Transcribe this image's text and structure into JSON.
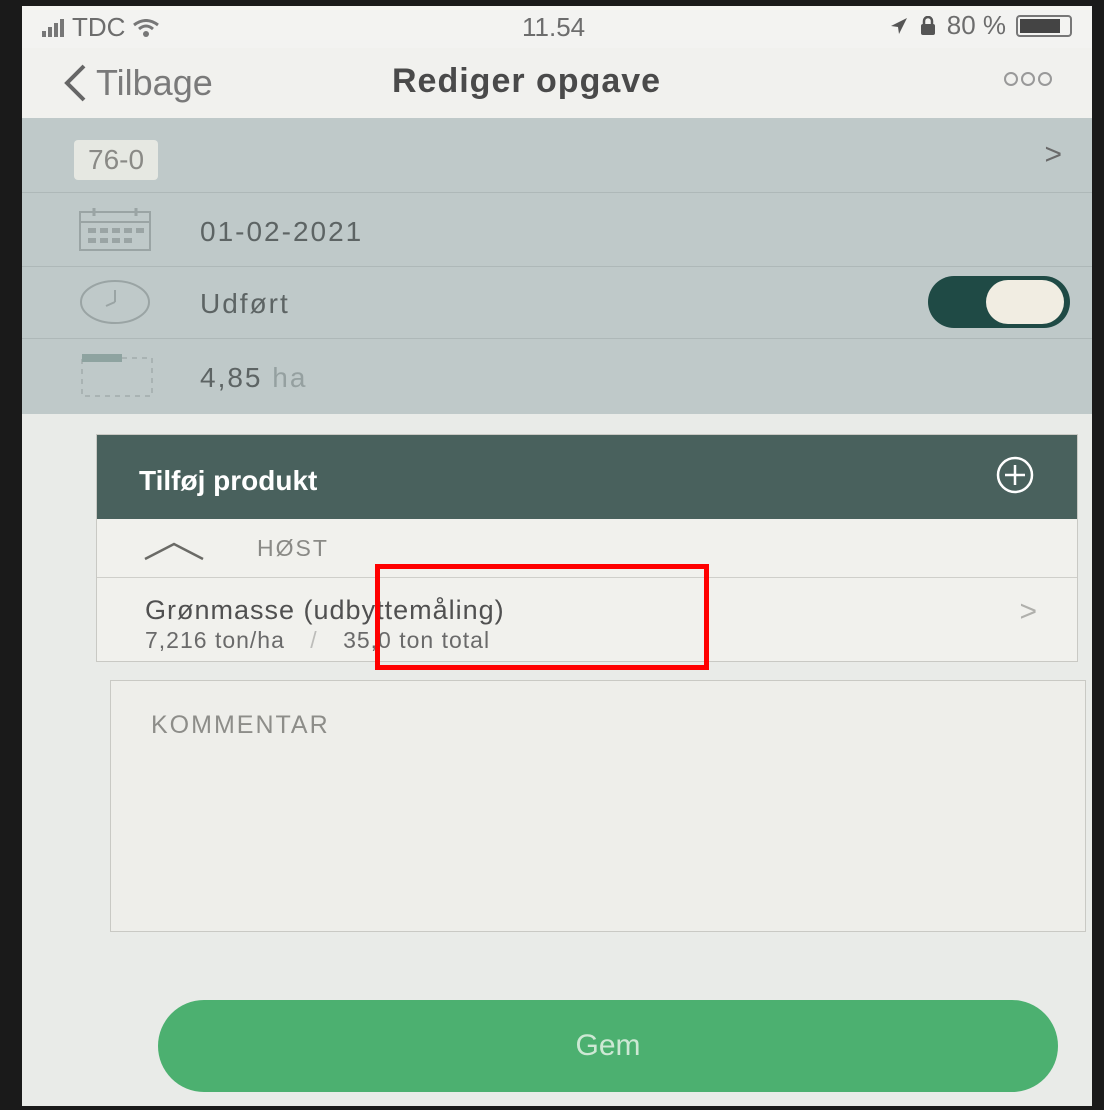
{
  "status_bar": {
    "carrier": "TDC",
    "time": "11.54",
    "battery": "80 %"
  },
  "nav": {
    "back_label": "Tilbage",
    "title": "Rediger opgave"
  },
  "task": {
    "id": "76-0",
    "date": "01-02-2021",
    "status_label": "Udført",
    "completed": true,
    "area_value": "4,85",
    "area_unit": "ha"
  },
  "products": {
    "header_label": "Tilføj produkt",
    "section_label": "HØST",
    "item": {
      "name": "Grønmasse (udbyttemåling)",
      "rate": "7,216 ton/ha",
      "separator": "/",
      "total": "35,0 ton total"
    }
  },
  "comment": {
    "placeholder": "KOMMENTAR"
  },
  "actions": {
    "save_label": "Gem"
  },
  "colors": {
    "header_panel": "#bfc9c9",
    "card_header": "#49615d",
    "toggle_on": "#1f4a45",
    "save_button": "#4cb070",
    "highlight": "#ff0000"
  }
}
